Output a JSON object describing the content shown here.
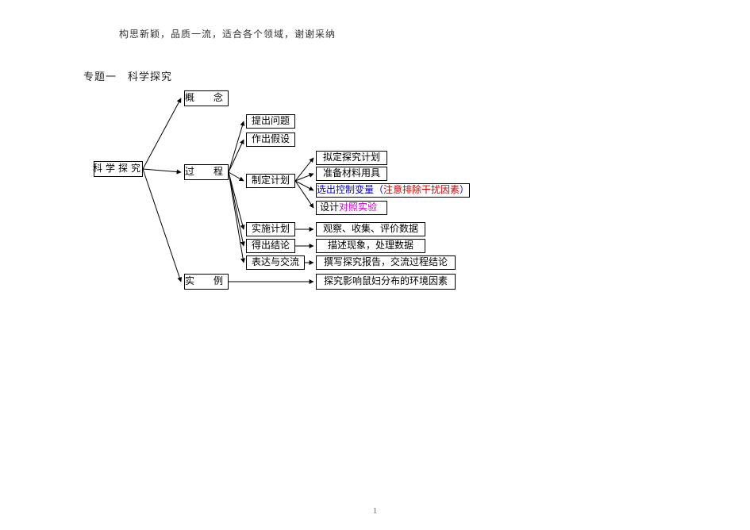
{
  "header_note": "构思新颖，品质一流，适合各个领域，谢谢采纳",
  "section_title": "专题一　科学探究",
  "page_number": "1",
  "root": "科学探究",
  "branches": {
    "concept": "概　念",
    "process": "过　程",
    "example": "实　例"
  },
  "process_steps": {
    "p1": "提出问题",
    "p2": "作出假设",
    "p3": "制定计划",
    "p4": "实施计划",
    "p5": "得出结论",
    "p6": "表达与交流"
  },
  "plan_details": {
    "d1": "拟定探究计划",
    "d2": "准备材料用具",
    "d3a": "选出控制变量（",
    "d3b": "注意排除干扰因素",
    "d3c": "）",
    "d4a": "设计",
    "d4b": "对照实验"
  },
  "exec_details": {
    "d5": "观察、收集、评价数据",
    "d6": "描述现象，处理数据",
    "d7": "撰写探究报告，交流过程结论"
  },
  "example_detail": "探究影响鼠妇分布的环境因素"
}
